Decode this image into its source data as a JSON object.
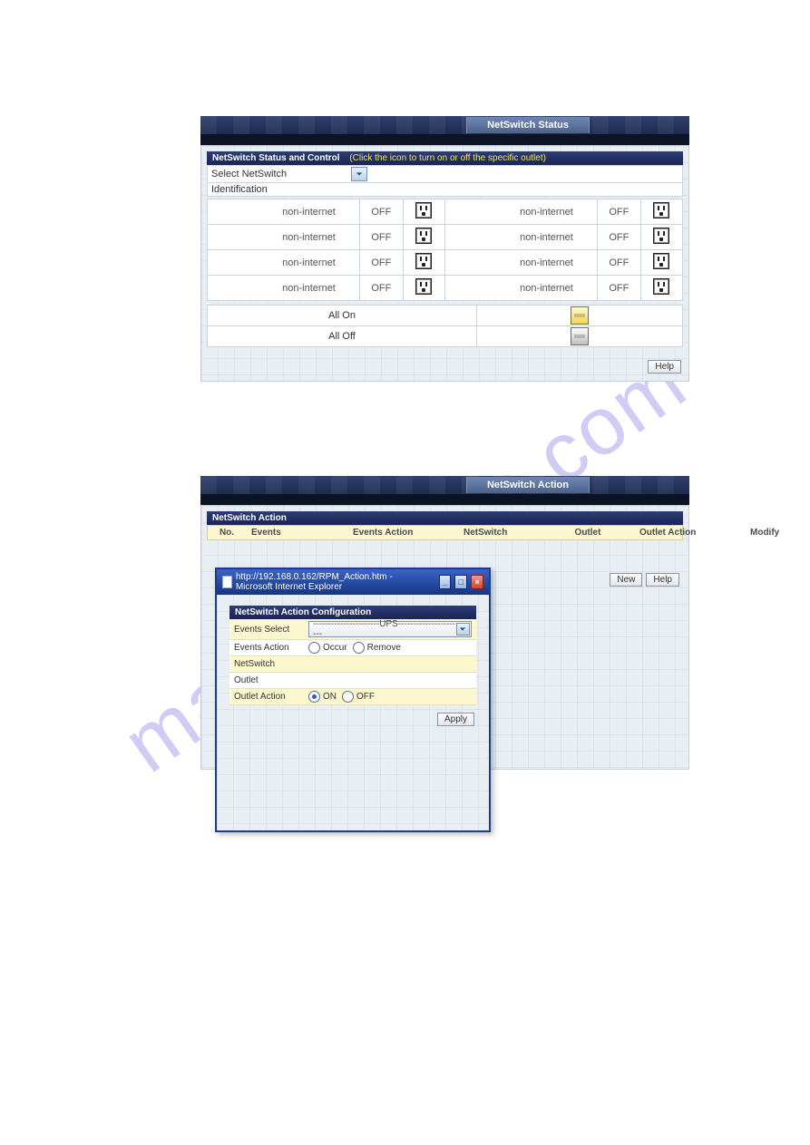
{
  "watermark": "manualshive.com",
  "common": {
    "help": "Help"
  },
  "status": {
    "title": "NetSwitch Status",
    "section_title": "NetSwitch Status and Control",
    "section_hint": "(Click the icon to turn on or off the specific outlet)",
    "select_label": "Select NetSwitch",
    "identification_label": "Identification",
    "all_on_label": "All On",
    "all_off_label": "All Off",
    "outlets": [
      {
        "name": "non-internet",
        "state": "OFF"
      },
      {
        "name": "non-internet",
        "state": "OFF"
      },
      {
        "name": "non-internet",
        "state": "OFF"
      },
      {
        "name": "non-internet",
        "state": "OFF"
      },
      {
        "name": "non-internet",
        "state": "OFF"
      },
      {
        "name": "non-internet",
        "state": "OFF"
      },
      {
        "name": "non-internet",
        "state": "OFF"
      },
      {
        "name": "non-internet",
        "state": "OFF"
      }
    ]
  },
  "action": {
    "title": "NetSwitch Action",
    "section_title": "NetSwitch Action",
    "new_label": "New",
    "columns": {
      "no": "No.",
      "events": "Events",
      "events_action": "Events Action",
      "netswitch": "NetSwitch",
      "outlet": "Outlet",
      "outlet_action": "Outlet Action",
      "modify": "Modify"
    }
  },
  "popup": {
    "window_title": "http://192.168.0.162/RPM_Action.htm - Microsoft Internet Explorer",
    "header": "NetSwitch Action Configuration",
    "events_select_label": "Events Select",
    "events_select_value": "----------------------UPS----------------------",
    "events_action_label": "Events Action",
    "occur": "Occur",
    "remove": "Remove",
    "netswitch_label": "NetSwitch",
    "outlet_label": "Outlet",
    "outlet_action_label": "Outlet Action",
    "on": "ON",
    "off": "OFF",
    "apply": "Apply"
  }
}
